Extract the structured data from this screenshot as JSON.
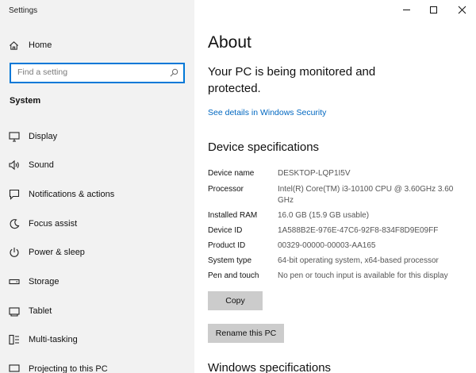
{
  "app": {
    "title": "Settings"
  },
  "sidebar": {
    "home_label": "Home",
    "search_placeholder": "Find a setting",
    "section_label": "System",
    "items": [
      {
        "label": "Display",
        "icon": "display-icon"
      },
      {
        "label": "Sound",
        "icon": "sound-icon"
      },
      {
        "label": "Notifications & actions",
        "icon": "notifications-icon"
      },
      {
        "label": "Focus assist",
        "icon": "focus-assist-icon"
      },
      {
        "label": "Power & sleep",
        "icon": "power-icon"
      },
      {
        "label": "Storage",
        "icon": "storage-icon"
      },
      {
        "label": "Tablet",
        "icon": "tablet-icon"
      },
      {
        "label": "Multi-tasking",
        "icon": "multitasking-icon"
      },
      {
        "label": "Projecting to this PC",
        "icon": "projecting-icon"
      }
    ]
  },
  "main": {
    "title": "About",
    "monitor_text": "Your PC is being monitored and protected.",
    "security_link": "See details in Windows Security",
    "device_spec_heading": "Device specifications",
    "specs": [
      {
        "label": "Device name",
        "value": "DESKTOP-LQP1I5V"
      },
      {
        "label": "Processor",
        "value": "Intel(R) Core(TM) i3-10100 CPU @ 3.60GHz   3.60 GHz"
      },
      {
        "label": "Installed RAM",
        "value": "16.0 GB (15.9 GB usable)"
      },
      {
        "label": "Device ID",
        "value": "1A588B2E-976E-47C6-92F8-834F8D9E09FF"
      },
      {
        "label": "Product ID",
        "value": "00329-00000-00003-AA165"
      },
      {
        "label": "System type",
        "value": "64-bit operating system, x64-based processor"
      },
      {
        "label": "Pen and touch",
        "value": "No pen or touch input is available for this display"
      }
    ],
    "copy_button": "Copy",
    "rename_button": "Rename this PC",
    "windows_spec_heading": "Windows specifications"
  },
  "colors": {
    "accent": "#0078d7",
    "link": "#0067c0",
    "sidebar_bg": "#f2f2f2",
    "button_bg": "#cccccc"
  }
}
